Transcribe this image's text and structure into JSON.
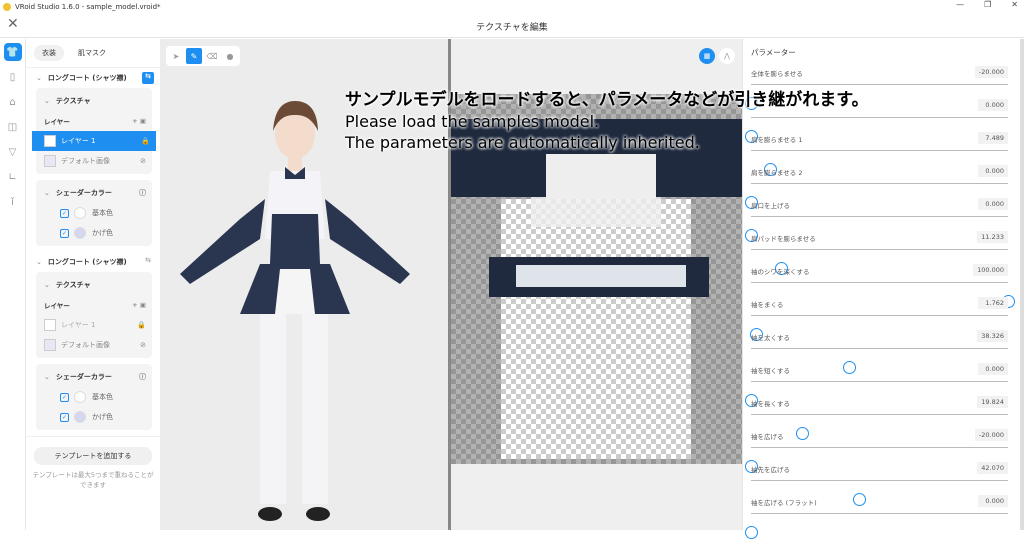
{
  "window": {
    "title": "VRoid Studio 1.6.0 - sample_model.vroid*",
    "controls": [
      "—",
      "❐",
      "✕"
    ]
  },
  "header": {
    "title": "テクスチャを編集",
    "close": "✕"
  },
  "rail": [
    "shirt-icon",
    "pants-icon",
    "shoe-accessory-icon",
    "top-icon",
    "bra-icon",
    "sock-icon",
    "tie-icon"
  ],
  "panel": {
    "tabs": [
      "衣装",
      "肌マスク"
    ],
    "groups": [
      {
        "title": "ロングコート (シャツ襟)",
        "texture": "テクスチャ",
        "layers_label": "レイヤー",
        "layers": [
          "レイヤー 1",
          "デフォルト画像"
        ],
        "shader": "シェーダーカラー",
        "colors": [
          {
            "label": "基本色",
            "hex": "#ffffff"
          },
          {
            "label": "かげ色",
            "hex": "#d4d6f2"
          }
        ]
      },
      {
        "title": "ロングコート (シャツ襟)",
        "texture": "テクスチャ",
        "layers_label": "レイヤー",
        "layers": [
          "レイヤー 1",
          "デフォルト画像"
        ],
        "shader": "シェーダーカラー",
        "colors": [
          {
            "label": "基本色",
            "hex": "#ffffff"
          },
          {
            "label": "かげ色",
            "hex": "#d4d6f2"
          }
        ]
      }
    ],
    "add_template": "テンプレートを追加する",
    "note": "テンプレートは最大5つまで重ねることができます"
  },
  "overlay": {
    "jp": "サンプルモデルをロードすると、パラメータなどが引き継がれます。",
    "en1": "Please load the samples model.",
    "en2": "The parameters are automatically inherited."
  },
  "params": {
    "title": "パラメーター",
    "items": [
      {
        "label": "全体を膨らませる",
        "value": "-20.000",
        "pos": 0
      },
      {
        "label": "",
        "value": "0.000",
        "pos": 0
      },
      {
        "label": "肩を膨らませる 1",
        "value": "7.489",
        "pos": 0.075
      },
      {
        "label": "肩を膨らませる 2",
        "value": "0.000",
        "pos": 0
      },
      {
        "label": "肩口を上げる",
        "value": "0.000",
        "pos": 0
      },
      {
        "label": "肩パッドを膨らませる",
        "value": "11.233",
        "pos": 0.115
      },
      {
        "label": "袖のシワを深くする",
        "value": "100.000",
        "pos": 1
      },
      {
        "label": "袖をまくる",
        "value": "1.762",
        "pos": 0.018
      },
      {
        "label": "袖を太くする",
        "value": "38.326",
        "pos": 0.383
      },
      {
        "label": "袖を短くする",
        "value": "0.000",
        "pos": 0
      },
      {
        "label": "袖を長くする",
        "value": "19.824",
        "pos": 0.2
      },
      {
        "label": "袖を広げる",
        "value": "-20.000",
        "pos": 0
      },
      {
        "label": "袖先を広げる",
        "value": "42.070",
        "pos": 0.42
      },
      {
        "label": "袖を広げる (フラット)",
        "value": "0.000",
        "pos": 0
      }
    ]
  },
  "accent": "#1e8ff0"
}
